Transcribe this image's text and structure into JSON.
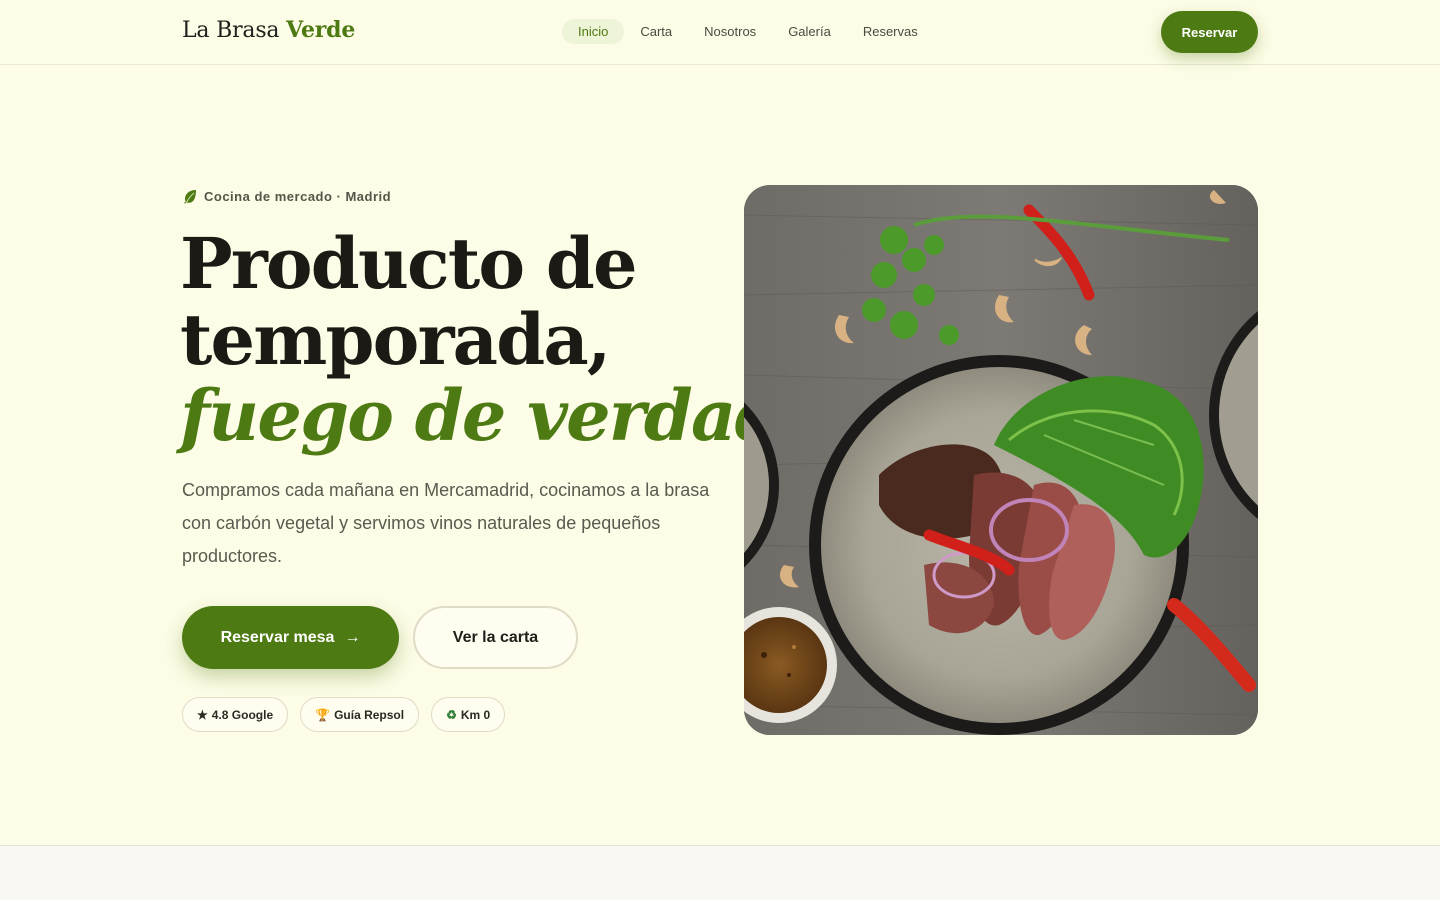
{
  "brand": {
    "name_part1": "La Brasa",
    "name_part2": "Verde"
  },
  "nav": {
    "items": [
      {
        "label": "Inicio",
        "active": true
      },
      {
        "label": "Carta",
        "active": false
      },
      {
        "label": "Nosotros",
        "active": false
      },
      {
        "label": "Galería",
        "active": false
      },
      {
        "label": "Reservas",
        "active": false
      }
    ]
  },
  "header": {
    "cta_label": "Reservar"
  },
  "hero": {
    "eyebrow": "Cocina de mercado · Madrid",
    "eyebrow_icon": "leaf-icon",
    "headline_line1": "Producto de",
    "headline_line2": "temporada,",
    "headline_line3": "fuego de verdad",
    "lead": "Compramos cada mañana en Mercamadrid, cocinamos a la brasa con carbón vegetal y servimos vinos naturales de pequeños productores.",
    "primary_cta": "Reservar mesa",
    "primary_cta_icon": "arrow-right-icon",
    "secondary_cta": "Ver la carta",
    "badges": [
      {
        "icon": "★",
        "icon_name": "star-icon",
        "label": "4.8 Google"
      },
      {
        "icon": "🏆",
        "icon_name": "trophy-icon",
        "label": "Guía Repsol"
      },
      {
        "icon": "♻",
        "icon_name": "recycle-icon",
        "label": "Km 0"
      }
    ],
    "image_subject": "grilled-steak-plate"
  },
  "colors": {
    "accent": "#4d7a12",
    "background": "#fdfce6",
    "text": "#1b1a14",
    "muted": "#5a5a50"
  }
}
